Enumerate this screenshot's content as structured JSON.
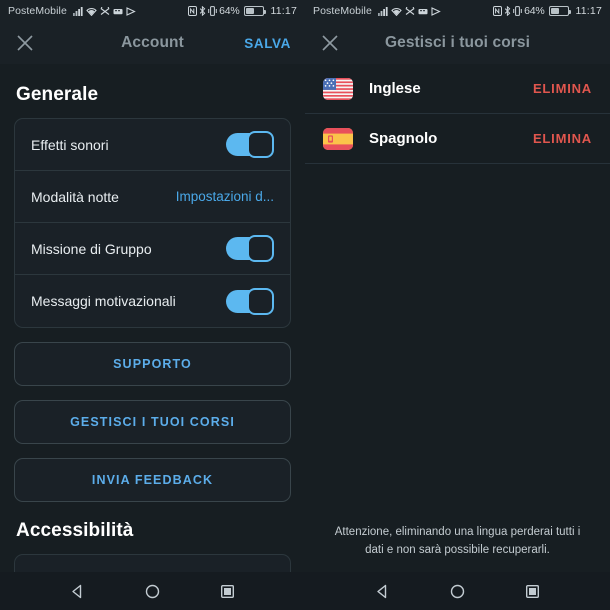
{
  "statusbar": {
    "carrier": "PosteMobile",
    "battery_pct": "64%",
    "time": "11:17",
    "icons": [
      "signal-bars-icon",
      "wifi-icon",
      "alarm-off-icon",
      "vibrate-icon",
      "data-saver-icon",
      "nfc-icon",
      "bluetooth-icon",
      "mute-icon"
    ]
  },
  "left_screen": {
    "header": {
      "close_label": "close-icon",
      "title": "Account",
      "action": "SALVA"
    },
    "sections": [
      {
        "title": "Generale"
      },
      {
        "title": "Accessibilità"
      }
    ],
    "rows": [
      {
        "label": "Effetti sonori",
        "type": "toggle",
        "value": "on"
      },
      {
        "label": "Modalità notte",
        "type": "value",
        "value": "Impostazioni d..."
      },
      {
        "label": "Missione di Gruppo",
        "type": "toggle",
        "value": "on"
      },
      {
        "label": "Messaggi motivazionali",
        "type": "toggle",
        "value": "on"
      }
    ],
    "buttons": [
      {
        "label": "SUPPORTO"
      },
      {
        "label": "GESTISCI I TUOI CORSI"
      },
      {
        "label": "INVIA FEEDBACK"
      }
    ]
  },
  "right_screen": {
    "header": {
      "close_label": "close-icon",
      "title": "Gestisci i tuoi corsi"
    },
    "languages": [
      {
        "flag": "flag-usa-icon",
        "name": "Inglese",
        "action": "ELIMINA"
      },
      {
        "flag": "flag-spain-icon",
        "name": "Spagnolo",
        "action": "ELIMINA"
      }
    ],
    "note": "Attenzione, eliminando una lingua perderai tutti i dati e non sarà possibile recuperarli."
  },
  "navbar": {
    "back": "back-triangle-icon",
    "home": "home-circle-icon",
    "recents": "recents-square-icon"
  },
  "colors": {
    "background": "#171e22",
    "card": "#1a2127",
    "accent_blue": "#4aa8e8",
    "toggle_on": "#5cb8f0",
    "danger_red": "#e0564e",
    "text_primary": "#ffffff",
    "text_muted": "#8b979e"
  }
}
